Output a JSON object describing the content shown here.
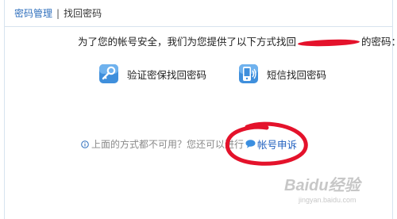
{
  "breadcrumb": {
    "parent": "密码管理",
    "separator": "|",
    "current": "找回密码"
  },
  "instruction": {
    "prefix": "为了您的帐号安全，我们为您提供了以下方式找回",
    "suffix": "的密码："
  },
  "options": [
    {
      "label": "验证密保找回密码",
      "icon": "key-icon"
    },
    {
      "label": "短信找回密码",
      "icon": "phone-icon"
    }
  ],
  "alternative": {
    "text": "上面的方式都不可用？您还可以进行",
    "link_label": "帐号申诉"
  },
  "watermark": {
    "brand": "Baidu经验",
    "url": "jingyan.baidu.com"
  },
  "colors": {
    "link": "#1f5fbf",
    "annotation": "#e4122b",
    "border": "#d7e3ef"
  }
}
